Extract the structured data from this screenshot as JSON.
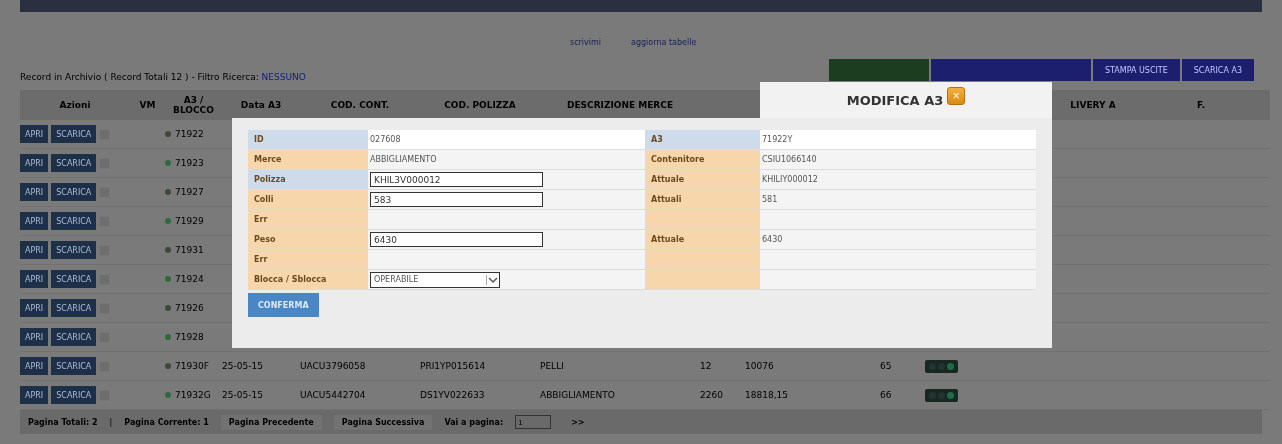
{
  "summary": {
    "label": "Record in Archivio ( Record Totali 12 ) - Filtro Ricerca:",
    "filter": "NESSUNO"
  },
  "links": [
    "scrivimi",
    "aggiorna tabelle"
  ],
  "toolbar_buttons": [
    {
      "label": "STAMPA USCITE",
      "color": "#1c1f6e"
    },
    {
      "label": "SCARICA A3",
      "color": "#1c1f6e"
    }
  ],
  "columns": [
    "Azioni",
    "VM",
    "A3 / BLOCCO",
    "Data A3",
    "COD. CONT.",
    "COD. POLIZZA",
    "DESCRIZIONE MERCE",
    "",
    "",
    "",
    "",
    "LIVERY A",
    "F."
  ],
  "rows": [
    {
      "apri": "APRI",
      "scarica": "SCARICA",
      "checked": false,
      "color": "#3c4a3c",
      "a3": "71922"
    },
    {
      "apri": "APRI",
      "scarica": "SCARICA",
      "checked": false,
      "color": "#2f6b3a",
      "a3": "71923"
    },
    {
      "apri": "APRI",
      "scarica": "SCARICA",
      "checked": false,
      "color": "#3c4a3c",
      "a3": "71927"
    },
    {
      "apri": "APRI",
      "scarica": "SCARICA",
      "checked": false,
      "color": "#2f6b3a",
      "a3": "71929"
    },
    {
      "apri": "APRI",
      "scarica": "SCARICA",
      "checked": false,
      "color": "#3c4a3c",
      "a3": "71931"
    },
    {
      "apri": "APRI",
      "scarica": "SCARICA",
      "checked": false,
      "color": "#2f6b3a",
      "a3": "71924"
    },
    {
      "apri": "APRI",
      "scarica": "SCARICA",
      "checked": false,
      "color": "#3c4a3c",
      "a3": "71926"
    },
    {
      "apri": "APRI",
      "scarica": "SCARICA",
      "checked": false,
      "color": "#2f6b3a",
      "a3": "71928"
    },
    {
      "apri": "APRI",
      "scarica": "SCARICA",
      "checked": false,
      "color": "#3c4a3c",
      "a3": "71930F",
      "cells": [
        "25-05-15",
        "UACU3796058",
        "PRI1YP015614",
        "PELLI",
        "12",
        "10076",
        "65"
      ],
      "light": {
        "color": "#1f6b4a"
      }
    },
    {
      "apri": "APRI",
      "scarica": "SCARICA",
      "checked": false,
      "color": "#2f6b3a",
      "a3": "71932G",
      "cells": [
        "25-05-15",
        "UACU5442704",
        "DS1YV022633",
        "ABBIGLIAMENTO",
        "2260",
        "18818,15",
        "66"
      ],
      "light": {
        "color": "#1f6b4a"
      }
    }
  ],
  "pager": {
    "total": "Pagina Totali: 2",
    "separator": "|",
    "current": "Pagina Corrente: 1",
    "prev": "Pagina Precedente",
    "next": "Pagina Successiva",
    "goto_label": "Vai a pagina:",
    "goto_value": "1",
    "go": ">>"
  },
  "modal": {
    "title": "MODIFICA A3",
    "close": "×",
    "confirm": "CONFERMA",
    "rows": [
      {
        "label": "ID",
        "color": "#cddbea",
        "kind": "text",
        "value": "027608",
        "right": {
          "label": "A3",
          "color": "#cddbea",
          "value": "71922Y"
        }
      },
      {
        "label": "Merce",
        "color": "#f6d6aa",
        "kind": "text",
        "value": "ABBIGLIAMENTO",
        "right": {
          "label": "Contenitore",
          "color": "#f6d6aa",
          "value": "CSIU1066140"
        }
      },
      {
        "label": "Polizza",
        "color": "#cddbea",
        "kind": "input",
        "value": "KHIL3V000012",
        "right": {
          "label": "Attuale",
          "color": "#f6d6aa",
          "value": "KHILIY000012"
        }
      },
      {
        "label": "Colli",
        "color": "#f6d6aa",
        "kind": "input",
        "value": "583",
        "right": {
          "label": "Attuali",
          "color": "#f6d6aa",
          "value": "581"
        }
      },
      {
        "label": "Err",
        "color": "#f6d6aa",
        "kind": "empty",
        "right": {
          "color": "#f6d6aa"
        }
      },
      {
        "label": "Peso",
        "color": "#f6d6aa",
        "kind": "input",
        "value": "6430",
        "right": {
          "label": "Attuale",
          "color": "#f6d6aa",
          "value": "6430"
        }
      },
      {
        "label": "Err",
        "color": "#f6d6aa",
        "kind": "empty",
        "right": {
          "color": "#f6d6aa"
        }
      },
      {
        "label": "Blocca / Sblocca",
        "color": "#f6d6aa",
        "kind": "select",
        "value": "OPERABILE",
        "right": {
          "color": "#f6d6aa"
        }
      }
    ]
  }
}
